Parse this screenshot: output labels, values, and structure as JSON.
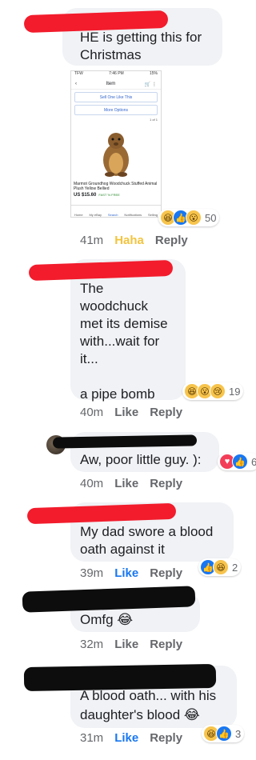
{
  "comments": [
    {
      "text": "HE is getting this for\nChristmas",
      "time": "41m",
      "actions": [
        "Haha",
        "Reply"
      ],
      "reactions": {
        "icons": [
          "haha",
          "like",
          "wow"
        ],
        "count": "50"
      },
      "screenshot": {
        "status_left": "TFW",
        "status_time": "7:46 PM",
        "status_right": "15%",
        "nav_title": "Item",
        "sell_btn": "Sell One Like This",
        "more_btn": "More Options",
        "pager": "1 of 1",
        "product_title": "Marmot Groundhog Woodchuck Stuffed Animal Plush Yellow Bellied",
        "price": "US $15.60",
        "shipping": "FAST 'N FREE",
        "tabs": [
          "Home",
          "My eBay",
          "Search",
          "Notifications",
          "Selling"
        ]
      }
    },
    {
      "text": "The\nwoodchuck\nmet its demise\nwith...wait for\nit...\n\na pipe bomb",
      "time": "40m",
      "actions": [
        "Like",
        "Reply"
      ],
      "reactions": {
        "icons": [
          "haha",
          "wow",
          "sad"
        ],
        "count": "19"
      }
    },
    {
      "text": "Aw, poor little guy. ):",
      "time": "40m",
      "actions": [
        "Like",
        "Reply"
      ],
      "reactions": {
        "icons": [
          "love",
          "like"
        ],
        "count": "6"
      }
    },
    {
      "text": "My dad swore a blood\noath against it",
      "time": "39m",
      "actions": [
        "Like",
        "Reply"
      ],
      "reactions": {
        "icons": [
          "like",
          "haha"
        ],
        "count": "2"
      }
    },
    {
      "text": "Omfg 😂",
      "time": "32m",
      "actions": [
        "Like",
        "Reply"
      ]
    },
    {
      "text": "A blood oath... with his\ndaughter's blood 😂",
      "time": "31m",
      "actions": [
        "Like",
        "Reply"
      ],
      "reactions": {
        "icons": [
          "haha",
          "like"
        ],
        "count": "3"
      }
    }
  ],
  "colors": {
    "bubble": "#f0f2f5",
    "like_blue": "#1877f2",
    "haha_yellow": "#f2c43f",
    "redact_red": "#f21c2c",
    "redact_black": "#0d0d0d"
  }
}
